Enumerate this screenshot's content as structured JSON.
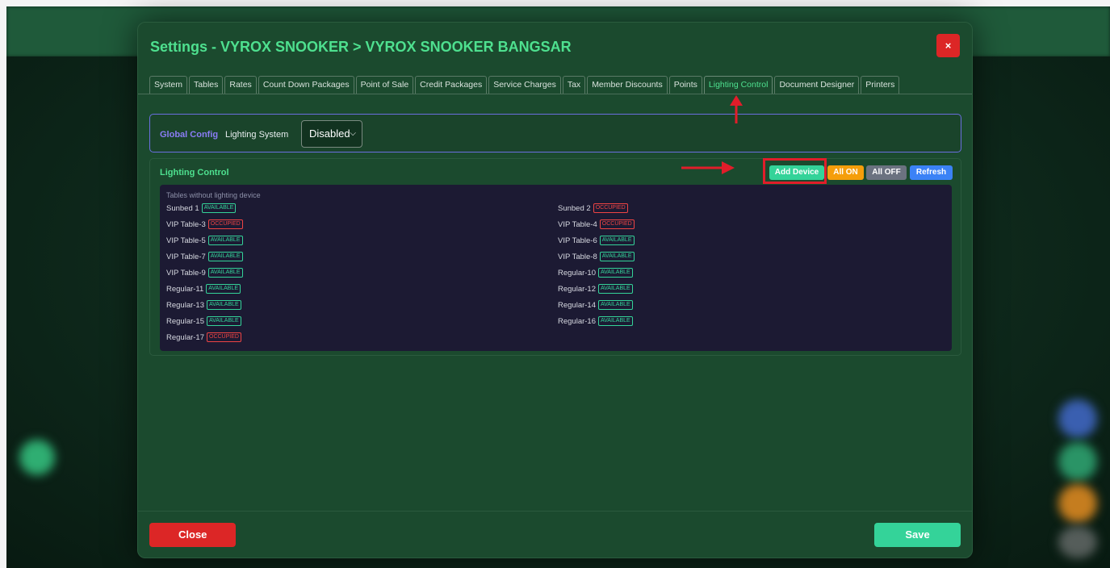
{
  "modal": {
    "title": "Settings - VYROX SNOOKER > VYROX SNOOKER BANGSAR",
    "close_icon": "×"
  },
  "tabs": [
    {
      "label": "System"
    },
    {
      "label": "Tables"
    },
    {
      "label": "Rates"
    },
    {
      "label": "Count Down Packages"
    },
    {
      "label": "Point of Sale"
    },
    {
      "label": "Credit Packages"
    },
    {
      "label": "Service Charges"
    },
    {
      "label": "Tax"
    },
    {
      "label": "Member Discounts"
    },
    {
      "label": "Points"
    },
    {
      "label": "Lighting Control",
      "active": true
    },
    {
      "label": "Document Designer"
    },
    {
      "label": "Printers"
    }
  ],
  "global_config": {
    "title": "Global Config",
    "label": "Lighting System",
    "selected": "Disabled"
  },
  "lighting_control": {
    "title": "Lighting Control",
    "buttons": {
      "add_device": "Add Device",
      "all_on": "All ON",
      "all_off": "All OFF",
      "refresh": "Refresh"
    },
    "list_heading": "Tables without lighting device",
    "tables": [
      {
        "name": "Sunbed 1",
        "status": "AVAILABLE"
      },
      {
        "name": "Sunbed 2",
        "status": "OCCUPIED"
      },
      {
        "name": "VIP Table-3",
        "status": "OCCUPIED"
      },
      {
        "name": "VIP Table-4",
        "status": "OCCUPIED"
      },
      {
        "name": "VIP Table-5",
        "status": "AVAILABLE"
      },
      {
        "name": "VIP Table-6",
        "status": "AVAILABLE"
      },
      {
        "name": "VIP Table-7",
        "status": "AVAILABLE"
      },
      {
        "name": "VIP Table-8",
        "status": "AVAILABLE"
      },
      {
        "name": "VIP Table-9",
        "status": "AVAILABLE"
      },
      {
        "name": "Regular-10",
        "status": "AVAILABLE"
      },
      {
        "name": "Regular-11",
        "status": "AVAILABLE"
      },
      {
        "name": "Regular-12",
        "status": "AVAILABLE"
      },
      {
        "name": "Regular-13",
        "status": "AVAILABLE"
      },
      {
        "name": "Regular-14",
        "status": "AVAILABLE"
      },
      {
        "name": "Regular-15",
        "status": "AVAILABLE"
      },
      {
        "name": "Regular-16",
        "status": "AVAILABLE"
      },
      {
        "name": "Regular-17",
        "status": "OCCUPIED"
      }
    ]
  },
  "footer": {
    "close_label": "Close",
    "save_label": "Save"
  },
  "colors": {
    "accent_green": "#4ee08f",
    "available": "#34d399",
    "occupied": "#ef4444",
    "annotation_red": "#e11d2a"
  }
}
